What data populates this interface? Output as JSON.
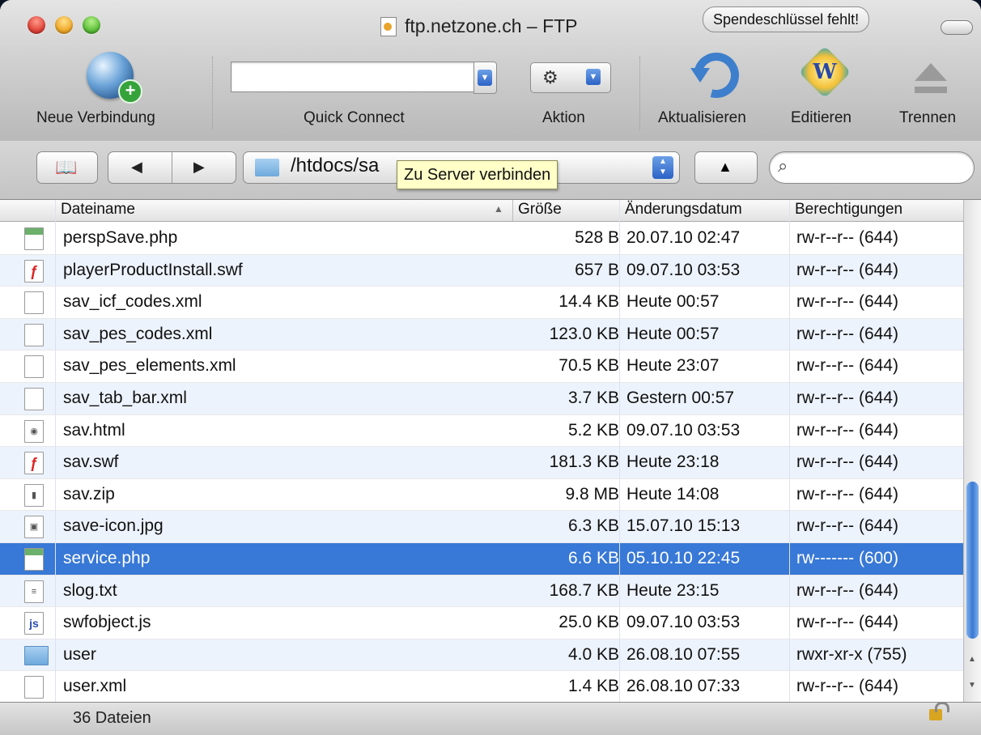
{
  "window": {
    "title": "ftp.netzone.ch – FTP",
    "badge": "Spendeschlüssel fehlt!"
  },
  "toolbar": {
    "new_connection": "Neue Verbindung",
    "quick_connect": "Quick Connect",
    "quick_connect_value": "",
    "action": "Aktion",
    "refresh": "Aktualisieren",
    "edit": "Editieren",
    "disconnect": "Trennen"
  },
  "navbar": {
    "path": "/htdocs/sa",
    "tooltip": "Zu Server verbinden",
    "search_value": ""
  },
  "table": {
    "columns": {
      "name": "Dateiname",
      "size": "Größe",
      "modified": "Änderungsdatum",
      "permissions": "Berechtigungen"
    },
    "rows": [
      {
        "icon": "php-file-icon",
        "name": "perspSave.php",
        "size": "528 B",
        "modified": "20.07.10 02:47",
        "perm": "rw-r--r-- (644)"
      },
      {
        "icon": "swf-file-icon",
        "name": "playerProductInstall.swf",
        "size": "657 B",
        "modified": "09.07.10 03:53",
        "perm": "rw-r--r-- (644)"
      },
      {
        "icon": "xml-file-icon",
        "name": "sav_icf_codes.xml",
        "size": "14.4 KB",
        "modified": "Heute 00:57",
        "perm": "rw-r--r-- (644)"
      },
      {
        "icon": "xml-file-icon",
        "name": "sav_pes_codes.xml",
        "size": "123.0 KB",
        "modified": "Heute 00:57",
        "perm": "rw-r--r-- (644)"
      },
      {
        "icon": "xml-file-icon",
        "name": "sav_pes_elements.xml",
        "size": "70.5 KB",
        "modified": "Heute 23:07",
        "perm": "rw-r--r-- (644)"
      },
      {
        "icon": "xml-file-icon",
        "name": "sav_tab_bar.xml",
        "size": "3.7 KB",
        "modified": "Gestern 00:57",
        "perm": "rw-r--r-- (644)"
      },
      {
        "icon": "html-file-icon",
        "name": "sav.html",
        "size": "5.2 KB",
        "modified": "09.07.10 03:53",
        "perm": "rw-r--r-- (644)"
      },
      {
        "icon": "swf-file-icon",
        "name": "sav.swf",
        "size": "181.3 KB",
        "modified": "Heute 23:18",
        "perm": "rw-r--r-- (644)"
      },
      {
        "icon": "zip-file-icon",
        "name": "sav.zip",
        "size": "9.8 MB",
        "modified": "Heute 14:08",
        "perm": "rw-r--r-- (644)"
      },
      {
        "icon": "jpg-file-icon",
        "name": "save-icon.jpg",
        "size": "6.3 KB",
        "modified": "15.07.10 15:13",
        "perm": "rw-r--r-- (644)"
      },
      {
        "icon": "php-file-icon",
        "name": "service.php",
        "size": "6.6 KB",
        "modified": "05.10.10 22:45",
        "perm": "rw------- (600)",
        "selected": true
      },
      {
        "icon": "txt-file-icon",
        "name": "slog.txt",
        "size": "168.7 KB",
        "modified": "Heute 23:15",
        "perm": "rw-r--r-- (644)"
      },
      {
        "icon": "js-file-icon",
        "name": "swfobject.js",
        "size": "25.0 KB",
        "modified": "09.07.10 03:53",
        "perm": "rw-r--r-- (644)"
      },
      {
        "icon": "folder-icon",
        "name": "user",
        "size": "4.0 KB",
        "modified": "26.08.10 07:55",
        "perm": "rwxr-xr-x (755)"
      },
      {
        "icon": "xml-file-icon",
        "name": "user.xml",
        "size": "1.4 KB",
        "modified": "26.08.10 07:33",
        "perm": "rw-r--r-- (644)"
      }
    ]
  },
  "status": {
    "count": "36 Dateien"
  }
}
